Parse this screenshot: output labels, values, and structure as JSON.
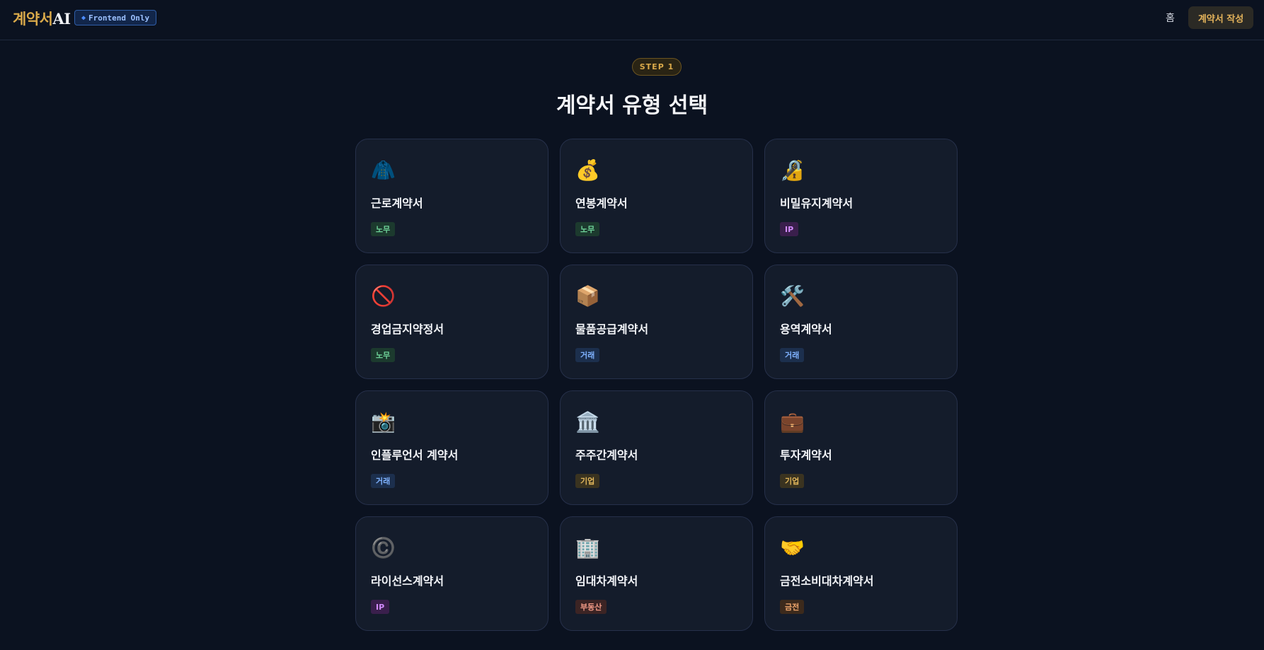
{
  "header": {
    "logo_part1": "계약서",
    "logo_part2": "AI",
    "badge_icon": "◆",
    "badge_label": "Frontend Only",
    "nav_home": "홈",
    "write_button": "계약서 작성"
  },
  "step": {
    "label": "STEP 1"
  },
  "page_title": "계약서 유형 선택",
  "cards": [
    {
      "icon": "🧥",
      "icon_name": "shirt-tie-icon",
      "name": "근로계약서",
      "tag": "노무",
      "tag_class": "labor"
    },
    {
      "icon": "💰",
      "icon_name": "money-bag-icon",
      "name": "연봉계약서",
      "tag": "노무",
      "tag_class": "labor"
    },
    {
      "icon": "🔏",
      "icon_name": "lock-icon",
      "name": "비밀유지계약서",
      "tag": "IP",
      "tag_class": "ip"
    },
    {
      "icon": "🚫",
      "icon_name": "prohibited-icon",
      "name": "경업금지약정서",
      "tag": "노무",
      "tag_class": "labor"
    },
    {
      "icon": "📦",
      "icon_name": "package-icon",
      "name": "물품공급계약서",
      "tag": "거래",
      "tag_class": "trade"
    },
    {
      "icon": "🛠️",
      "icon_name": "tools-icon",
      "name": "용역계약서",
      "tag": "거래",
      "tag_class": "trade"
    },
    {
      "icon": "📸",
      "icon_name": "camera-icon",
      "name": "인플루언서 계약서",
      "tag": "거래",
      "tag_class": "trade"
    },
    {
      "icon": "🏛️",
      "icon_name": "bank-building-icon",
      "name": "주주간계약서",
      "tag": "기업",
      "tag_class": "corp"
    },
    {
      "icon": "💼",
      "icon_name": "briefcase-icon",
      "name": "투자계약서",
      "tag": "기업",
      "tag_class": "corp"
    },
    {
      "icon": "©️",
      "icon_name": "copyright-icon",
      "name": "라이선스계약서",
      "tag": "IP",
      "tag_class": "ip"
    },
    {
      "icon": "🏢",
      "icon_name": "office-building-icon",
      "name": "임대차계약서",
      "tag": "부동산",
      "tag_class": "realty"
    },
    {
      "icon": "🤝",
      "icon_name": "handshake-icon",
      "name": "금전소비대차계약서",
      "tag": "금전",
      "tag_class": "finance"
    }
  ]
}
